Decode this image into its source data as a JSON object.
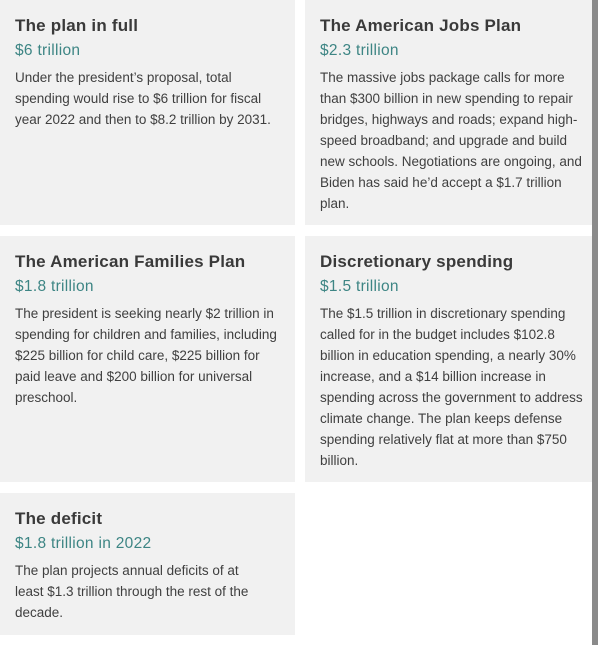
{
  "cards": [
    {
      "title": "The plan in full",
      "amount": "$6 trillion",
      "body": "Under the president’s proposal, total spending would rise to $6 trillion for fiscal year 2022 and then to $8.2 trillion by 2031."
    },
    {
      "title": "The American Jobs Plan",
      "amount": "$2.3 trillion",
      "body": "The massive jobs package calls for more than $300 billion in new spending to repair bridges, highways and roads; expand high-speed broadband; and upgrade and build new schools. Negotiations are ongoing, and Biden has said he’d accept a $1.7 trillion plan."
    },
    {
      "title": "The American Families Plan",
      "amount": "$1.8 trillion",
      "body": "The president is seeking nearly $2 trillion in spending for children and families, including $225 billion for child care, $225 billion for paid leave and $200 billion for universal preschool."
    },
    {
      "title": "Discretionary spending",
      "amount": "$1.5 trillion",
      "body": "The $1.5 trillion in discretionary spending called for in the budget includes $102.8 billion in education spending, a nearly 30% increase, and a $14 billion increase in spending across the government to address climate change. The plan keeps defense spending relatively flat at more than $750 billion."
    },
    {
      "title": "The deficit",
      "amount": "$1.8 trillion in 2022",
      "body": "The plan projects annual deficits of at least $1.3 trillion through the rest of the decade."
    }
  ],
  "colors": {
    "card_background": "#f1f1f1",
    "title": "#3a3a3a",
    "amount": "#3d8584",
    "body": "#3f3f3f",
    "right_rule": "#8a8a8a"
  }
}
